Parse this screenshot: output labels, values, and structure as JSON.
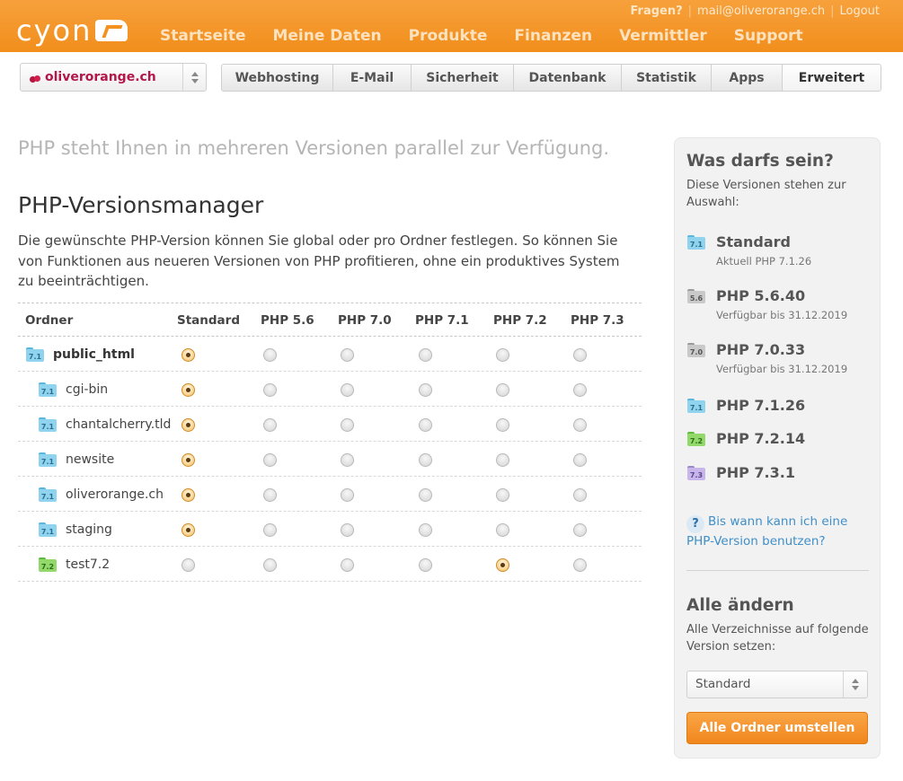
{
  "header": {
    "logo": "cyon",
    "nav": [
      "Startseite",
      "Meine Daten",
      "Produkte",
      "Finanzen",
      "Vermittler",
      "Support"
    ],
    "questions_label": "Fragen?",
    "email": "mail@oliverorange.ch",
    "logout": "Logout"
  },
  "domain_select": {
    "value": "oliverorange.ch"
  },
  "tabs": [
    "Webhosting",
    "E-Mail",
    "Sicherheit",
    "Datenbank",
    "Statistik",
    "Apps",
    "Erweitert"
  ],
  "active_tab": "Erweitert",
  "main": {
    "intro": "PHP steht Ihnen in mehreren Versionen parallel zur Verfügung.",
    "title": "PHP-Versionsmanager",
    "description": "Die gewünschte PHP-Version können Sie global oder pro Ordner festlegen. So können Sie von Funktionen aus neueren Versionen von PHP profitieren, ohne ein produktives System zu beeinträchtigen."
  },
  "table": {
    "columns": [
      "Ordner",
      "Standard",
      "PHP 5.6",
      "PHP 7.0",
      "PHP 7.1",
      "PHP 7.2",
      "PHP 7.3"
    ],
    "rows": [
      {
        "name": "public_html",
        "badge": "7.1",
        "color": "blue",
        "selected": 0,
        "root": true
      },
      {
        "name": "cgi-bin",
        "badge": "7.1",
        "color": "blue",
        "selected": 0,
        "root": false
      },
      {
        "name": "chantalcherry.tld",
        "badge": "7.1",
        "color": "blue",
        "selected": 0,
        "root": false
      },
      {
        "name": "newsite",
        "badge": "7.1",
        "color": "blue",
        "selected": 0,
        "root": false
      },
      {
        "name": "oliverorange.ch",
        "badge": "7.1",
        "color": "blue",
        "selected": 0,
        "root": false
      },
      {
        "name": "staging",
        "badge": "7.1",
        "color": "blue",
        "selected": 0,
        "root": false
      },
      {
        "name": "test7.2",
        "badge": "7.2",
        "color": "green",
        "selected": 4,
        "root": false
      }
    ]
  },
  "sidebar": {
    "title": "Was darfs sein?",
    "intro": "Diese Versionen stehen zur Auswahl:",
    "versions": [
      {
        "badge": "7.1",
        "color": "blue",
        "name": "Standard",
        "sub": "Aktuell PHP 7.1.26"
      },
      {
        "badge": "5.6",
        "color": "gray",
        "name": "PHP 5.6.40",
        "sub": "Verfügbar bis 31.12.2019"
      },
      {
        "badge": "7.0",
        "color": "gray",
        "name": "PHP 7.0.33",
        "sub": "Verfügbar bis 31.12.2019"
      },
      {
        "badge": "7.1",
        "color": "blue",
        "name": "PHP 7.1.26",
        "sub": ""
      },
      {
        "badge": "7.2",
        "color": "green",
        "name": "PHP 7.2.14",
        "sub": ""
      },
      {
        "badge": "7.3",
        "color": "purple",
        "name": "PHP 7.3.1",
        "sub": ""
      }
    ],
    "help": "Bis wann kann ich eine PHP-Version benutzen?",
    "help_icon": "?",
    "change_title": "Alle ändern",
    "change_text": "Alle Verzeichnisse auf folgende Version setzen:",
    "select_value": "Standard",
    "button": "Alle Ordner umstellen"
  },
  "colors": {
    "accent": "#f39220",
    "link": "#3f8fc8",
    "domain": "#b2174a"
  }
}
